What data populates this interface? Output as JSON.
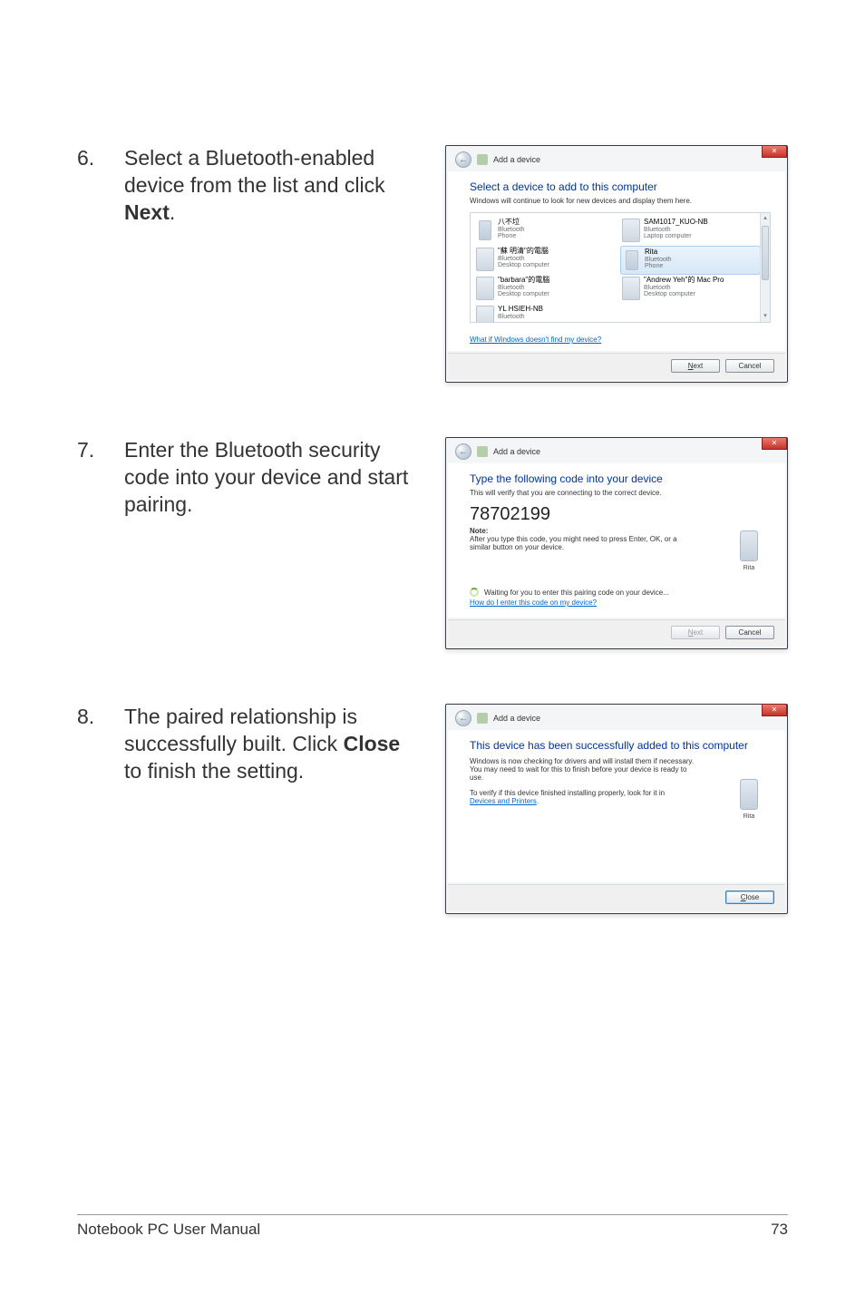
{
  "footer": {
    "left": "Notebook PC User Manual",
    "right": "73"
  },
  "steps": [
    {
      "num": "6.",
      "text_pre": "Select a Bluetooth-enabled device from the list and click ",
      "bold": "Next",
      "text_post": "."
    },
    {
      "num": "7.",
      "text_pre": "Enter the Bluetooth security code into your device and start pairing.",
      "bold": "",
      "text_post": ""
    },
    {
      "num": "8.",
      "text_pre": "The paired relationship is successfully built. Click ",
      "bold": "Close",
      "text_post": " to finish the setting."
    }
  ],
  "dialog_title": "Add a device",
  "close_x": "✕",
  "back_arrow": "←",
  "d1": {
    "heading": "Select a device to add to this computer",
    "sub": "Windows will continue to look for new devices and display them here.",
    "devices": [
      {
        "name": "八不垃",
        "line2": "Bluetooth",
        "line3": "Phone",
        "icon": "phone"
      },
      {
        "name": "SAM1017_KUO-NB",
        "line2": "Bluetooth",
        "line3": "Laptop computer",
        "icon": "pc"
      },
      {
        "name": "\"蘇 明清\"的電腦",
        "line2": "Bluetooth",
        "line3": "Desktop computer",
        "icon": "pc"
      },
      {
        "name": "Rita",
        "line2": "Bluetooth",
        "line3": "Phone",
        "icon": "phone",
        "selected": true
      },
      {
        "name": "\"barbara\"的電腦",
        "line2": "Bluetooth",
        "line3": "Desktop computer",
        "icon": "pc"
      },
      {
        "name": "\"Andrew Yeh\"的 Mac Pro",
        "line2": "Bluetooth",
        "line3": "Desktop computer",
        "icon": "pc"
      },
      {
        "name": "YL HSIEH-NB",
        "line2": "Bluetooth",
        "line3": "",
        "icon": "pc"
      }
    ],
    "link": "What if Windows doesn't find my device?",
    "next": "Next",
    "cancel": "Cancel"
  },
  "d2": {
    "heading": "Type the following code into your device",
    "sub": "This will verify that you are connecting to the correct device.",
    "code": "78702199",
    "note_label": "Note:",
    "note_text": "After you type this code, you might need to press Enter, OK, or a similar button on your device.",
    "device_label": "Rita",
    "wait": "Waiting for you to enter this pairing code on your device...",
    "link": "How do I enter this code on my device?",
    "next": "Next",
    "cancel": "Cancel"
  },
  "d3": {
    "heading": "This device has been successfully added to this computer",
    "p1": "Windows is now checking for drivers and will install them if necessary. You may need to wait for this to finish before your device is ready to use.",
    "p2_pre": "To verify if this device finished installing properly, look for it in ",
    "p2_link": "Devices and Printers",
    "device_label": "Rita",
    "close": "Close"
  }
}
